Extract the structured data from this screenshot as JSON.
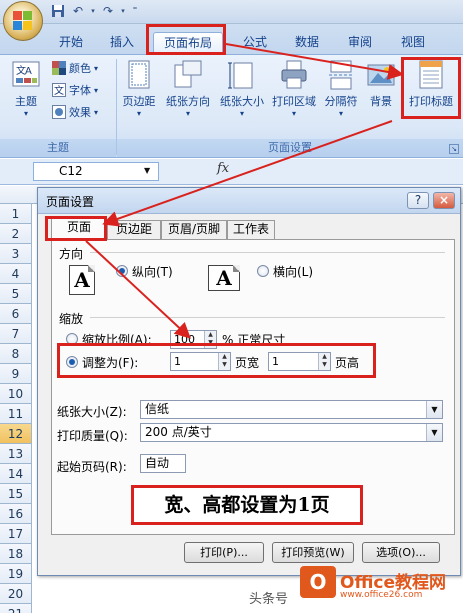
{
  "tabs": [
    "开始",
    "插入",
    "页面布局",
    "公式",
    "数据",
    "审阅",
    "视图"
  ],
  "ribbon": {
    "theme_group": {
      "label": "主题",
      "themes_btn": "主题",
      "colors": "颜色",
      "fonts": "字体",
      "effects": "效果",
      "dropdown": "▾"
    },
    "page_setup_group": {
      "label": "页面设置",
      "buttons": [
        "页边距",
        "纸张方向",
        "纸张大小",
        "打印区域",
        "分隔符",
        "背景",
        "打印标题"
      ]
    }
  },
  "formula_bar": {
    "cell_ref": "C12",
    "fx": "fx"
  },
  "rows": [
    "1",
    "2",
    "3",
    "4",
    "5",
    "6",
    "7",
    "8",
    "9",
    "10",
    "11",
    "12",
    "13",
    "14",
    "15",
    "16",
    "17",
    "18",
    "19",
    "20",
    "21"
  ],
  "selected_row": "12",
  "dialog": {
    "title": "页面设置",
    "help": "?",
    "close": "×",
    "tabs": [
      "页面",
      "页边距",
      "页眉/页脚",
      "工作表"
    ],
    "orientation_label": "方向",
    "portrait": "纵向(T)",
    "landscape": "横向(L)",
    "orient_glyph": "A",
    "scaling_label": "缩放",
    "adjust_to": "缩放比例(A):",
    "adjust_value": "100",
    "adjust_suffix": "% 正常尺寸",
    "fit_to": "调整为(F):",
    "fit_wide": "1",
    "fit_wide_label": "页宽",
    "fit_tall": "1",
    "fit_tall_label": "页高",
    "paper_size_label": "纸张大小(Z):",
    "paper_size": "信纸",
    "print_quality_label": "打印质量(Q):",
    "print_quality": "200 点/英寸",
    "first_page_label": "起始页码(R):",
    "first_page": "自动",
    "print_btn": "打印(P)...",
    "preview_btn": "打印预览(W)",
    "options_btn": "选项(O)..."
  },
  "annotation": "宽、高都设置为1页",
  "watermark": {
    "logo": "O",
    "site": "Office教程网",
    "url": "www.office26.com",
    "credit": "头条号"
  },
  "colors": {
    "highlight": "#d9221e",
    "ribbon_text": "#15428b"
  }
}
